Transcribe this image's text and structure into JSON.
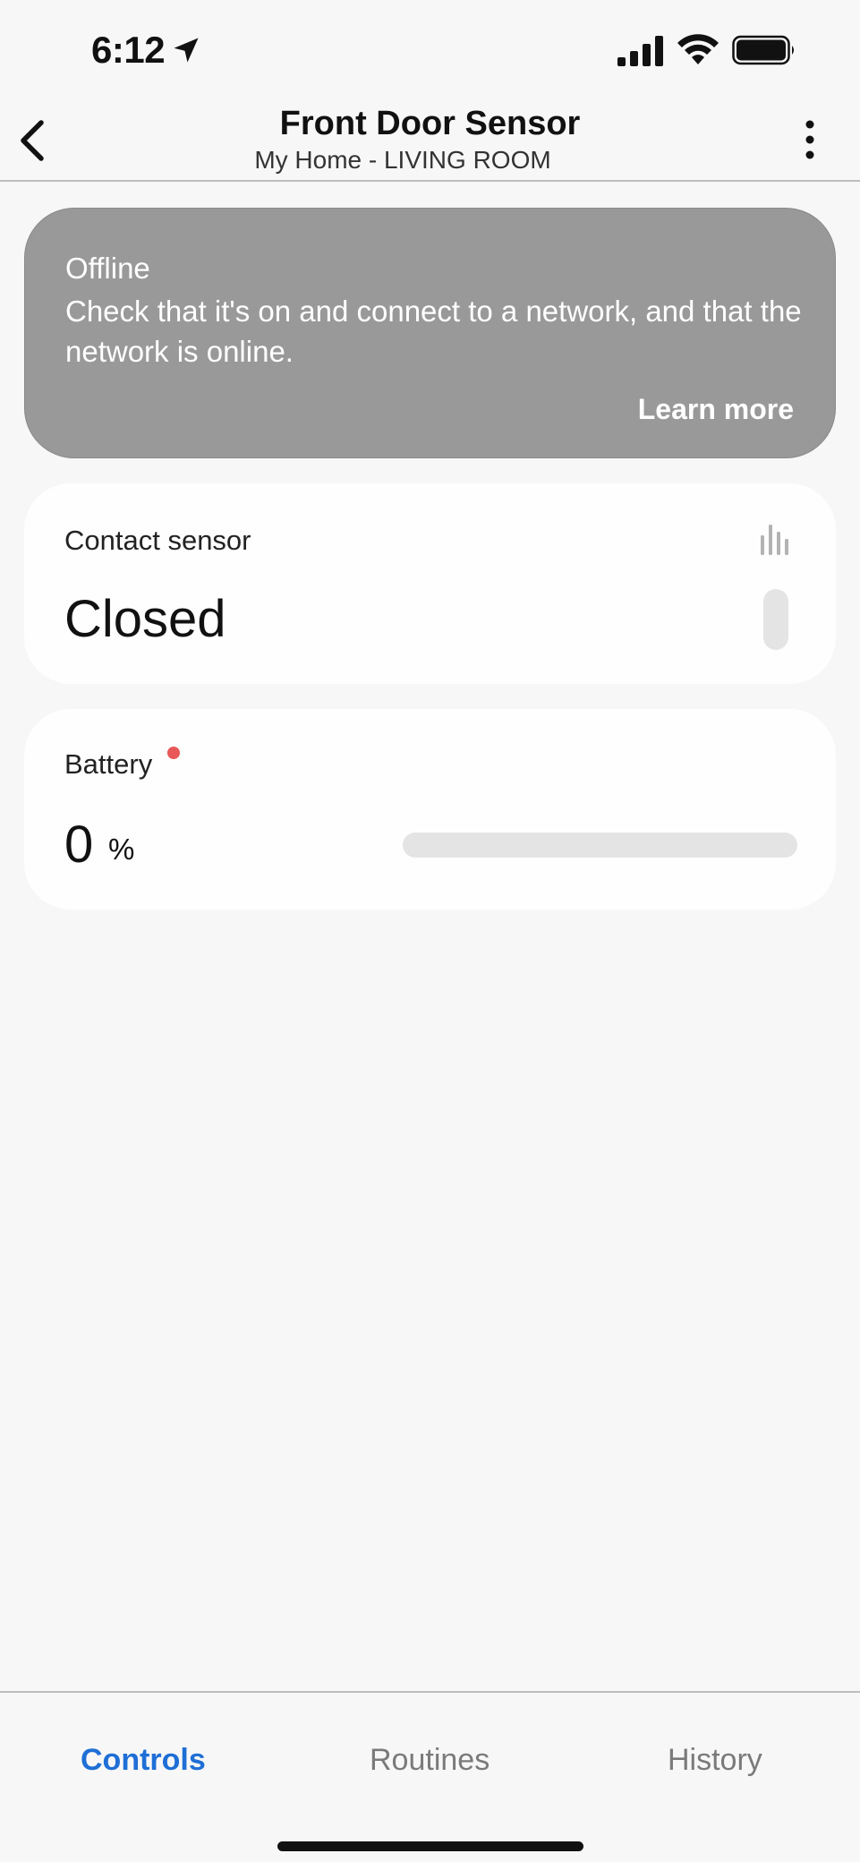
{
  "status_bar": {
    "time": "6:12"
  },
  "header": {
    "title": "Front Door Sensor",
    "subtitle": "My Home - LIVING ROOM"
  },
  "offline_banner": {
    "title": "Offline",
    "message": "Check that it's on and connect to a network, and that the network is online.",
    "learn_more": "Learn more"
  },
  "contact_sensor": {
    "label": "Contact sensor",
    "value": "Closed"
  },
  "battery": {
    "label": "Battery",
    "value": "0",
    "unit": "%",
    "level_percent": 0
  },
  "bottom_nav": {
    "tabs": [
      {
        "label": "Controls",
        "active": true
      },
      {
        "label": "Routines",
        "active": false
      },
      {
        "label": "History",
        "active": false
      }
    ]
  },
  "colors": {
    "accent": "#1f6fd6",
    "banner_bg": "#999999",
    "alert_dot": "#e85858"
  }
}
